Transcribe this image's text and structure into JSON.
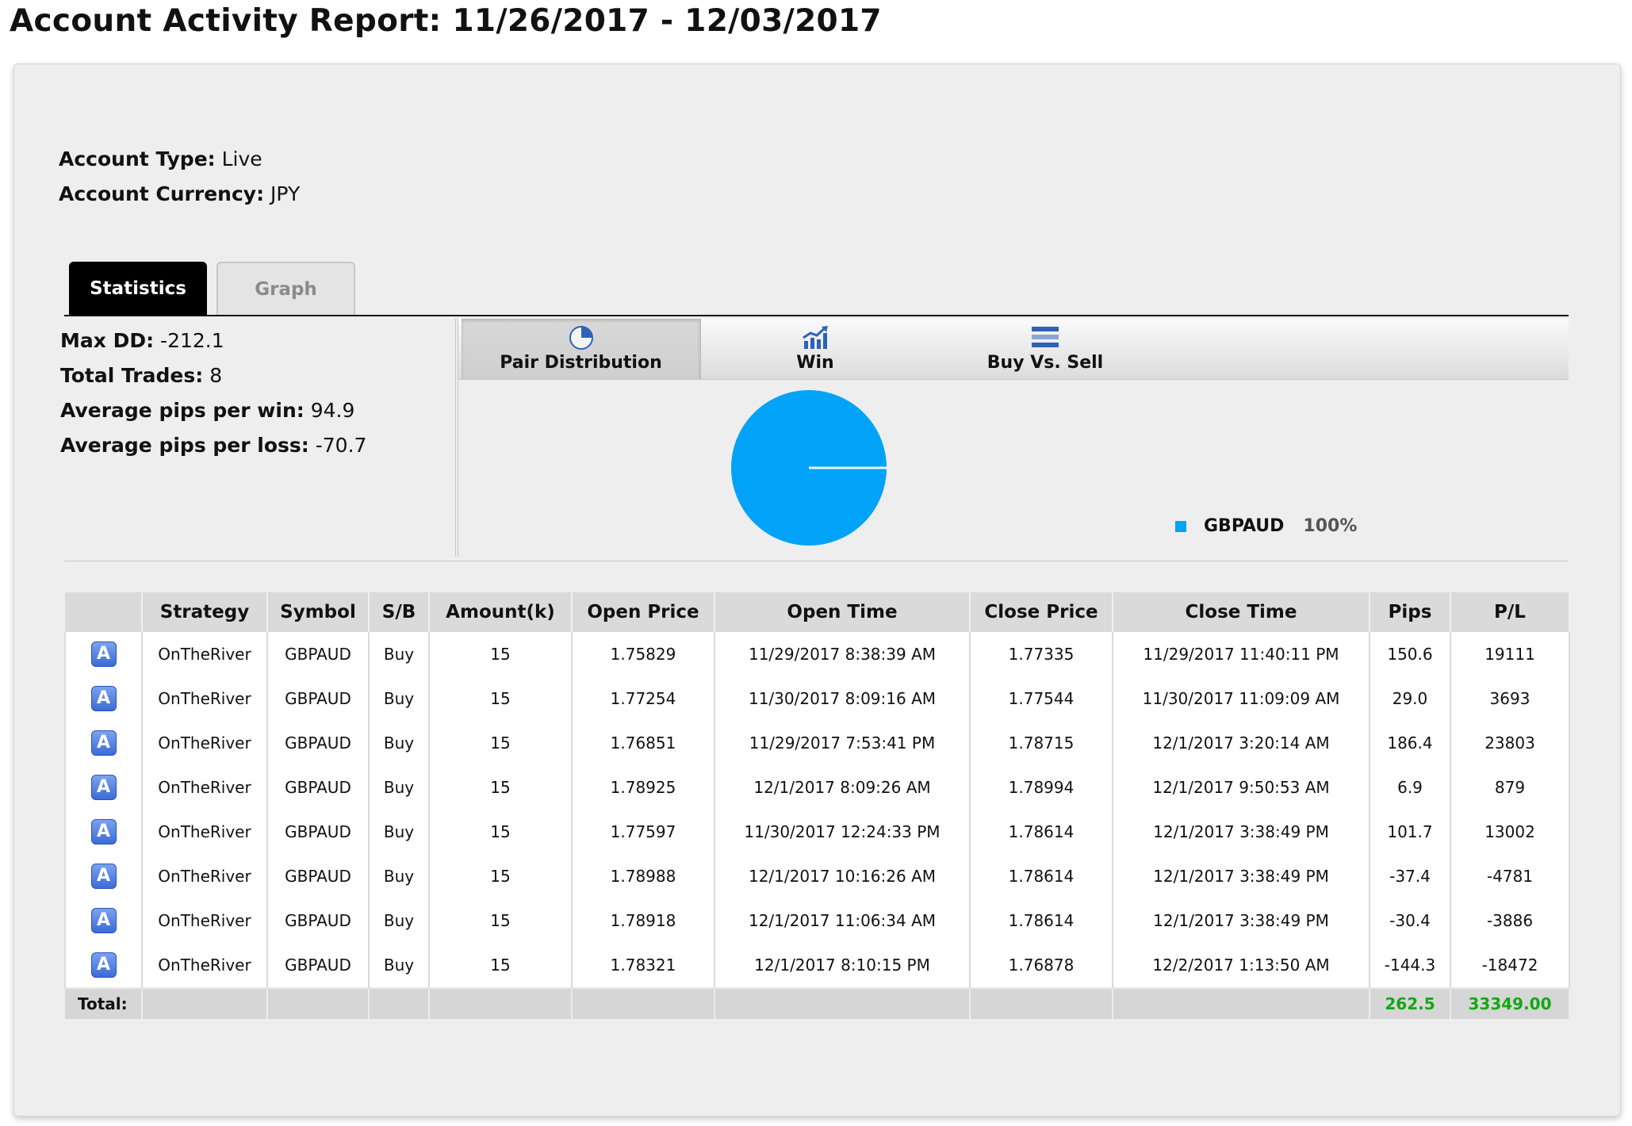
{
  "title": "Account Activity Report: 11/26/2017 - 12/03/2017",
  "account": {
    "type_label": "Account Type:",
    "type_value": "Live",
    "currency_label": "Account Currency:",
    "currency_value": "JPY"
  },
  "tabs": {
    "statistics": "Statistics",
    "graph": "Graph"
  },
  "stats": {
    "max_dd_label": "Max DD:",
    "max_dd_value": "-212.1",
    "total_trades_label": "Total Trades:",
    "total_trades_value": "8",
    "avg_win_label": "Average pips per win:",
    "avg_win_value": "94.9",
    "avg_loss_label": "Average pips per loss:",
    "avg_loss_value": "-70.7"
  },
  "chart_tabs": {
    "pair": "Pair Distribution",
    "win": "Win",
    "buy_sell": "Buy Vs. Sell"
  },
  "chart_data": {
    "type": "pie",
    "categories": [
      "GBPAUD"
    ],
    "values": [
      100
    ],
    "value_labels": [
      "100%"
    ],
    "colors": [
      "#00a3f7"
    ],
    "legend_position": "bottom-right"
  },
  "table": {
    "icon_letter": "A",
    "headers": [
      "",
      "Strategy",
      "Symbol",
      "S/B",
      "Amount(k)",
      "Open Price",
      "Open Time",
      "Close Price",
      "Close Time",
      "Pips",
      "P/L"
    ],
    "rows": [
      {
        "strategy": "OnTheRiver",
        "symbol": "GBPAUD",
        "sb": "Buy",
        "amount": "15",
        "open_price": "1.75829",
        "open_time": "11/29/2017 8:38:39 AM",
        "close_price": "1.77335",
        "close_time": "11/29/2017 11:40:11 PM",
        "pips": "150.6",
        "pl": "19111"
      },
      {
        "strategy": "OnTheRiver",
        "symbol": "GBPAUD",
        "sb": "Buy",
        "amount": "15",
        "open_price": "1.77254",
        "open_time": "11/30/2017 8:09:16 AM",
        "close_price": "1.77544",
        "close_time": "11/30/2017 11:09:09 AM",
        "pips": "29.0",
        "pl": "3693"
      },
      {
        "strategy": "OnTheRiver",
        "symbol": "GBPAUD",
        "sb": "Buy",
        "amount": "15",
        "open_price": "1.76851",
        "open_time": "11/29/2017 7:53:41 PM",
        "close_price": "1.78715",
        "close_time": "12/1/2017 3:20:14 AM",
        "pips": "186.4",
        "pl": "23803"
      },
      {
        "strategy": "OnTheRiver",
        "symbol": "GBPAUD",
        "sb": "Buy",
        "amount": "15",
        "open_price": "1.78925",
        "open_time": "12/1/2017 8:09:26 AM",
        "close_price": "1.78994",
        "close_time": "12/1/2017 9:50:53 AM",
        "pips": "6.9",
        "pl": "879"
      },
      {
        "strategy": "OnTheRiver",
        "symbol": "GBPAUD",
        "sb": "Buy",
        "amount": "15",
        "open_price": "1.77597",
        "open_time": "11/30/2017 12:24:33 PM",
        "close_price": "1.78614",
        "close_time": "12/1/2017 3:38:49 PM",
        "pips": "101.7",
        "pl": "13002"
      },
      {
        "strategy": "OnTheRiver",
        "symbol": "GBPAUD",
        "sb": "Buy",
        "amount": "15",
        "open_price": "1.78988",
        "open_time": "12/1/2017 10:16:26 AM",
        "close_price": "1.78614",
        "close_time": "12/1/2017 3:38:49 PM",
        "pips": "-37.4",
        "pl": "-4781"
      },
      {
        "strategy": "OnTheRiver",
        "symbol": "GBPAUD",
        "sb": "Buy",
        "amount": "15",
        "open_price": "1.78918",
        "open_time": "12/1/2017 11:06:34 AM",
        "close_price": "1.78614",
        "close_time": "12/1/2017 3:38:49 PM",
        "pips": "-30.4",
        "pl": "-3886"
      },
      {
        "strategy": "OnTheRiver",
        "symbol": "GBPAUD",
        "sb": "Buy",
        "amount": "15",
        "open_price": "1.78321",
        "open_time": "12/1/2017 8:10:15 PM",
        "close_price": "1.76878",
        "close_time": "12/2/2017 1:13:50 AM",
        "pips": "-144.3",
        "pl": "-18472"
      }
    ],
    "total_label": "Total:",
    "total_pips": "262.5",
    "total_pl": "33349.00"
  },
  "colors": {
    "positive": "#1fae1f",
    "negative": "#e0141a",
    "pie": "#00a3f7",
    "active_tab": "#000000"
  },
  "icons": {
    "row_action": "strategy-a-icon",
    "pair_distribution": "pie-chart-icon",
    "win": "trend-chart-icon",
    "buy_vs_sell": "bars-icon"
  }
}
